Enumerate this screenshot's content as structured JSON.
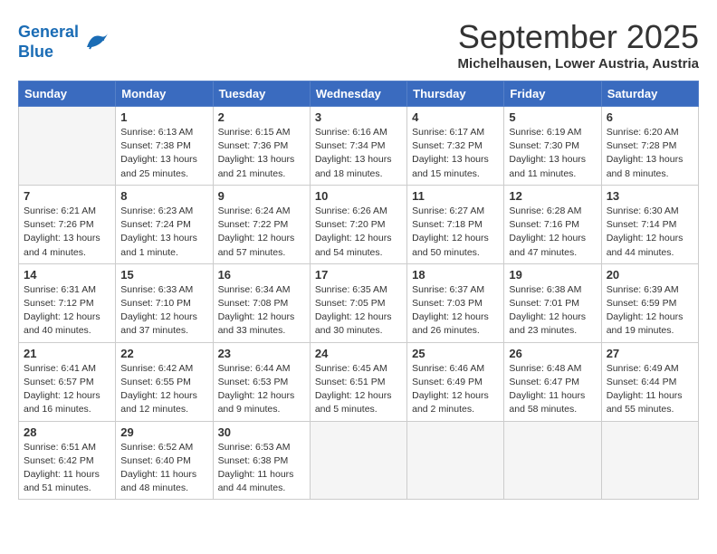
{
  "header": {
    "logo_line1": "General",
    "logo_line2": "Blue",
    "month": "September 2025",
    "location": "Michelhausen, Lower Austria, Austria"
  },
  "weekdays": [
    "Sunday",
    "Monday",
    "Tuesday",
    "Wednesday",
    "Thursday",
    "Friday",
    "Saturday"
  ],
  "weeks": [
    [
      {
        "day": "",
        "info": ""
      },
      {
        "day": "1",
        "info": "Sunrise: 6:13 AM\nSunset: 7:38 PM\nDaylight: 13 hours\nand 25 minutes."
      },
      {
        "day": "2",
        "info": "Sunrise: 6:15 AM\nSunset: 7:36 PM\nDaylight: 13 hours\nand 21 minutes."
      },
      {
        "day": "3",
        "info": "Sunrise: 6:16 AM\nSunset: 7:34 PM\nDaylight: 13 hours\nand 18 minutes."
      },
      {
        "day": "4",
        "info": "Sunrise: 6:17 AM\nSunset: 7:32 PM\nDaylight: 13 hours\nand 15 minutes."
      },
      {
        "day": "5",
        "info": "Sunrise: 6:19 AM\nSunset: 7:30 PM\nDaylight: 13 hours\nand 11 minutes."
      },
      {
        "day": "6",
        "info": "Sunrise: 6:20 AM\nSunset: 7:28 PM\nDaylight: 13 hours\nand 8 minutes."
      }
    ],
    [
      {
        "day": "7",
        "info": "Sunrise: 6:21 AM\nSunset: 7:26 PM\nDaylight: 13 hours\nand 4 minutes."
      },
      {
        "day": "8",
        "info": "Sunrise: 6:23 AM\nSunset: 7:24 PM\nDaylight: 13 hours\nand 1 minute."
      },
      {
        "day": "9",
        "info": "Sunrise: 6:24 AM\nSunset: 7:22 PM\nDaylight: 12 hours\nand 57 minutes."
      },
      {
        "day": "10",
        "info": "Sunrise: 6:26 AM\nSunset: 7:20 PM\nDaylight: 12 hours\nand 54 minutes."
      },
      {
        "day": "11",
        "info": "Sunrise: 6:27 AM\nSunset: 7:18 PM\nDaylight: 12 hours\nand 50 minutes."
      },
      {
        "day": "12",
        "info": "Sunrise: 6:28 AM\nSunset: 7:16 PM\nDaylight: 12 hours\nand 47 minutes."
      },
      {
        "day": "13",
        "info": "Sunrise: 6:30 AM\nSunset: 7:14 PM\nDaylight: 12 hours\nand 44 minutes."
      }
    ],
    [
      {
        "day": "14",
        "info": "Sunrise: 6:31 AM\nSunset: 7:12 PM\nDaylight: 12 hours\nand 40 minutes."
      },
      {
        "day": "15",
        "info": "Sunrise: 6:33 AM\nSunset: 7:10 PM\nDaylight: 12 hours\nand 37 minutes."
      },
      {
        "day": "16",
        "info": "Sunrise: 6:34 AM\nSunset: 7:08 PM\nDaylight: 12 hours\nand 33 minutes."
      },
      {
        "day": "17",
        "info": "Sunrise: 6:35 AM\nSunset: 7:05 PM\nDaylight: 12 hours\nand 30 minutes."
      },
      {
        "day": "18",
        "info": "Sunrise: 6:37 AM\nSunset: 7:03 PM\nDaylight: 12 hours\nand 26 minutes."
      },
      {
        "day": "19",
        "info": "Sunrise: 6:38 AM\nSunset: 7:01 PM\nDaylight: 12 hours\nand 23 minutes."
      },
      {
        "day": "20",
        "info": "Sunrise: 6:39 AM\nSunset: 6:59 PM\nDaylight: 12 hours\nand 19 minutes."
      }
    ],
    [
      {
        "day": "21",
        "info": "Sunrise: 6:41 AM\nSunset: 6:57 PM\nDaylight: 12 hours\nand 16 minutes."
      },
      {
        "day": "22",
        "info": "Sunrise: 6:42 AM\nSunset: 6:55 PM\nDaylight: 12 hours\nand 12 minutes."
      },
      {
        "day": "23",
        "info": "Sunrise: 6:44 AM\nSunset: 6:53 PM\nDaylight: 12 hours\nand 9 minutes."
      },
      {
        "day": "24",
        "info": "Sunrise: 6:45 AM\nSunset: 6:51 PM\nDaylight: 12 hours\nand 5 minutes."
      },
      {
        "day": "25",
        "info": "Sunrise: 6:46 AM\nSunset: 6:49 PM\nDaylight: 12 hours\nand 2 minutes."
      },
      {
        "day": "26",
        "info": "Sunrise: 6:48 AM\nSunset: 6:47 PM\nDaylight: 11 hours\nand 58 minutes."
      },
      {
        "day": "27",
        "info": "Sunrise: 6:49 AM\nSunset: 6:44 PM\nDaylight: 11 hours\nand 55 minutes."
      }
    ],
    [
      {
        "day": "28",
        "info": "Sunrise: 6:51 AM\nSunset: 6:42 PM\nDaylight: 11 hours\nand 51 minutes."
      },
      {
        "day": "29",
        "info": "Sunrise: 6:52 AM\nSunset: 6:40 PM\nDaylight: 11 hours\nand 48 minutes."
      },
      {
        "day": "30",
        "info": "Sunrise: 6:53 AM\nSunset: 6:38 PM\nDaylight: 11 hours\nand 44 minutes."
      },
      {
        "day": "",
        "info": ""
      },
      {
        "day": "",
        "info": ""
      },
      {
        "day": "",
        "info": ""
      },
      {
        "day": "",
        "info": ""
      }
    ]
  ]
}
